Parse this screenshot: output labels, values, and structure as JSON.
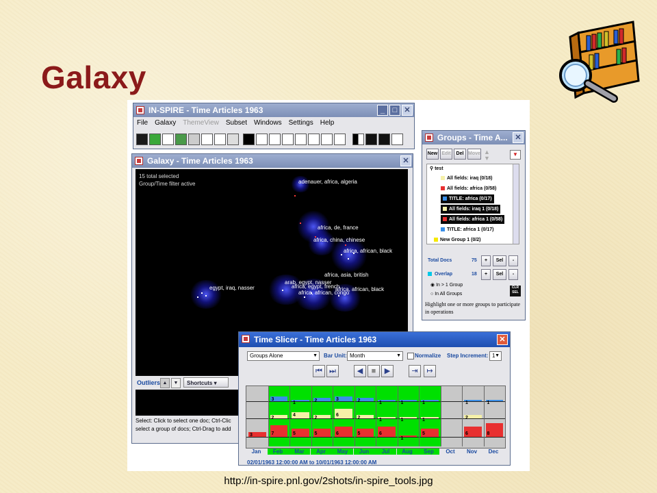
{
  "slide": {
    "title": "Galaxy",
    "url": "http://in-spire.pnl.gov/2shots/in-spire_tools.jpg"
  },
  "main_window": {
    "title": "IN-SPIRE - Time Articles 1963",
    "menu": [
      {
        "label": "File",
        "enabled": true
      },
      {
        "label": "Galaxy",
        "enabled": true
      },
      {
        "label": "ThemeView",
        "enabled": false
      },
      {
        "label": "Subset",
        "enabled": true
      },
      {
        "label": "Windows",
        "enabled": true
      },
      {
        "label": "Settings",
        "enabled": true
      },
      {
        "label": "Help",
        "enabled": true
      }
    ],
    "toolbar_icons": [
      "add-to-subset-icon",
      "check-icon",
      "scissors-icon",
      "groups-icon",
      "subset-icon",
      "zoom-icon",
      "hand-pan-icon",
      "select-icon",
      "star-field-icon",
      "documents-icon",
      "probe-icon",
      "hand-select-icon",
      "percent-icon",
      "query-icon",
      "tools-icon",
      "gradient-icon",
      "clear-selection-icon",
      "reverse-selection-icon",
      "undo-icon"
    ]
  },
  "galaxy_window": {
    "title": "Galaxy - Time Articles 1963",
    "info_line1": "15 total selected",
    "info_line2": "Group/Time filter active",
    "labels": [
      "adenauer, africa, algeria",
      "africa, de, france",
      "africa, china, chinese",
      "africa, african, black",
      "africa, asia, british",
      "arab, egypt, nasser",
      "africa, egypt, french",
      "africa, african, black",
      "egypt, iraq, nasser",
      "africa, african, congo"
    ],
    "outliers_label": "Outliers",
    "shortcuts_label": "Shortcuts",
    "status_line1": "Select: Click to select one doc; Ctrl-Clic",
    "status_line2": "select a group of docs; Ctrl-Drag to add"
  },
  "groups_window": {
    "title": "Groups - Time A...",
    "buttons": {
      "new": "New",
      "edit": "Edit",
      "del": "Del",
      "move": "Move"
    },
    "tree_root": "test",
    "tree_items": [
      {
        "label": "All fields: iraq (0/18)",
        "color": "#f5f0a8",
        "selected": false
      },
      {
        "label": "All fields: africa (0/58)",
        "color": "#e83030",
        "selected": false
      },
      {
        "label": "TITLE: africa (0/17)",
        "color": "#3a8fe8",
        "selected": true
      },
      {
        "label": "All fields: iraq 1 (0/18)",
        "color": "#f5f0a8",
        "selected": true
      },
      {
        "label": "All fields: africa 1 (0/58)",
        "color": "#e83030",
        "selected": true
      },
      {
        "label": "TITLE: africa 1 (0/17)",
        "color": "#3a8fe8",
        "selected": false
      },
      {
        "label": "New Group 1 (0/2)",
        "color": "#f5e800",
        "selected": false
      }
    ],
    "total_docs_label": "Total Docs",
    "total_docs_value": "75",
    "overlap_label": "Overlap",
    "overlap_value": "18",
    "plus_label": "+",
    "sel_label": "Sel",
    "minus_label": "-",
    "radio_1": "In > 1 Group",
    "radio_2": "In All Groups",
    "clear_sel": "CLR SEL",
    "help_text": "Highlight one or more groups to participate in operations"
  },
  "time_slicer": {
    "title": "Time Slicer - Time Articles 1963",
    "groups_select": "Groups Alone",
    "bar_unit_label": "Bar Unit:",
    "bar_unit_value": "Month",
    "normalize_label": "Normalize",
    "step_label": "Step Increment:",
    "step_value": "1",
    "months": [
      "Jan",
      "Feb",
      "Mar",
      "Apr",
      "May",
      "Jun",
      "Jul",
      "Aug",
      "Sep",
      "Oct",
      "Nov",
      "Dec"
    ],
    "row_blue": [
      "",
      "3",
      "1",
      "2",
      "3",
      "2",
      "1",
      "1",
      "1",
      "",
      "1",
      "1"
    ],
    "row_yellow": [
      "",
      "2",
      "4",
      "2",
      "6",
      "2",
      "1",
      "1",
      "1",
      "",
      "2",
      ""
    ],
    "row_red": [
      "3",
      "7",
      "5",
      "5",
      "6",
      "5",
      "6",
      "1",
      "5",
      "",
      "6",
      "8"
    ],
    "range_text": "02/01/1963 12:00:00 AM to 10/01/1963 12:00:00 AM",
    "colors": {
      "active": "#00e000",
      "inactive": "#c8c8c8",
      "red": "#e83030",
      "yellow": "#f5f0a8",
      "blue": "#3a8fe8"
    }
  }
}
